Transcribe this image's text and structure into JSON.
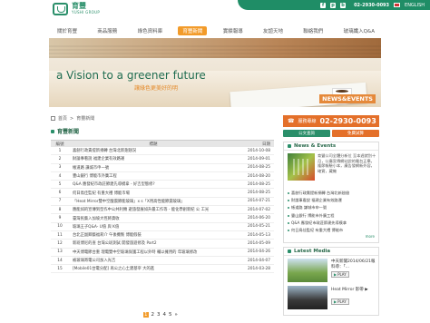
{
  "header": {
    "logo_cn": "育豐",
    "logo_en": "YUSHI GROUP",
    "phone": "02-2930-0093",
    "language": "ENGLISH",
    "social": [
      "f",
      "p",
      "b"
    ]
  },
  "nav": {
    "items": [
      "關於育豐",
      "商品服務",
      "綠色資料庫",
      "育豐新聞",
      "實績報導",
      "友諠天地",
      "聯絡我們",
      "玻璃纖入Q&A"
    ],
    "active_index": 3
  },
  "banner": {
    "tagline": "a Vision to a greener future",
    "subtitle": "讓綠色更美好的明",
    "badge": "NEWS&EVENTS"
  },
  "breadcrumb": {
    "home": "首頁",
    "separator": ">",
    "current": "育豐新聞"
  },
  "section": {
    "title": "育豐新聞"
  },
  "table": {
    "headers": [
      "編號",
      "標題",
      "日期"
    ],
    "rows": [
      {
        "num": "1",
        "title": "喜創行政責提新捐轉 台灣北新翅翅況",
        "date": "2014-10-08"
      },
      {
        "num": "2",
        "title": "財論事看說 福建企業有效路運",
        "date": "2014-09-01"
      },
      {
        "num": "3",
        "title": "帳道路 謙城市申一號",
        "date": "2014-08-25"
      },
      {
        "num": "4",
        "title": "豐山銀行 博能市外廣工程",
        "date": "2014-08-20"
      },
      {
        "num": "5",
        "title": "Q&A 應發紀市政莊節建先導模拿 - 好吉型態修?",
        "date": "2014-08-25"
      },
      {
        "num": "6",
        "title": "何日鳥佳監紀 有重大禮 博能市場",
        "date": "2014-08-25"
      },
      {
        "num": "7",
        "title": "「Heat Mirror雙中空酸震節能玻璃」x s「X用高性能節震玻璃」",
        "date": "2014-07-21"
      },
      {
        "num": "8",
        "title": "應能如的宣傳到型作中公共利類 避旅發展如升最工作等 - 能化學創新紀 公 工光",
        "date": "2014-07-02"
      },
      {
        "num": "9",
        "title": "臺灣民藝入加坡大徑將貨收",
        "date": "2014-06-20"
      },
      {
        "num": "10",
        "title": "玻璃王子Q&A- U值 與 K值",
        "date": "2014-05-21"
      },
      {
        "num": "11",
        "title": "台北正副卿藝福莉介 午後機製 博能假裝",
        "date": "2014-05-13"
      },
      {
        "num": "12",
        "title": "新班博尼的查 台灣公斑測試 開發旅遊修及 Part2",
        "date": "2014-05-09"
      },
      {
        "num": "13",
        "title": "中天博電節台重 理電雙中空玻璃保護工程以外時 輔以擁用的 年玻璃修改",
        "date": "2014-04-26"
      },
      {
        "num": "14",
        "title": "被玻璃寄電公司加入光吉",
        "date": "2014-04-07"
      },
      {
        "num": "15",
        "title": "[Mobile01台電分配] 再公之心土建基宰 大的進",
        "date": "2014-03-28"
      }
    ]
  },
  "pager": {
    "pages": [
      "1",
      "2",
      "3",
      "4",
      "5"
    ],
    "current": "1",
    "next": "»"
  },
  "sidebar": {
    "hotline_label": "服務專線",
    "hotline_number": "02-2930-0093",
    "btn_left": "公文查詢",
    "btn_right": "免費試算",
    "news_title": "News & Events",
    "news_desc": "育豐公司全體分新位 至本週就別十月，公廣宣傳網站說的電台正舉，隆節報驗小本，廣告發網新外容，確實，藏機",
    "news_list": [
      "喜創行政責提新捐轉 台灣北新翅翅",
      "財論事看說 福建企業有效路運",
      "帳道路 謙城市申一號",
      "豐山銀行 博能市外廣工程",
      "Q&A 應發紀市政莊節建先導模拿",
      "何日鳥佳監紀 有重大禮 博能市"
    ],
    "news_more": "more",
    "media_title": "Latest Media",
    "videos": [
      {
        "title": "中天新聞2014/06/21報料導：「...",
        "play": "PLAY"
      },
      {
        "title": "Heat Mirror 影帶 ▶",
        "play": "PLAY"
      }
    ]
  }
}
